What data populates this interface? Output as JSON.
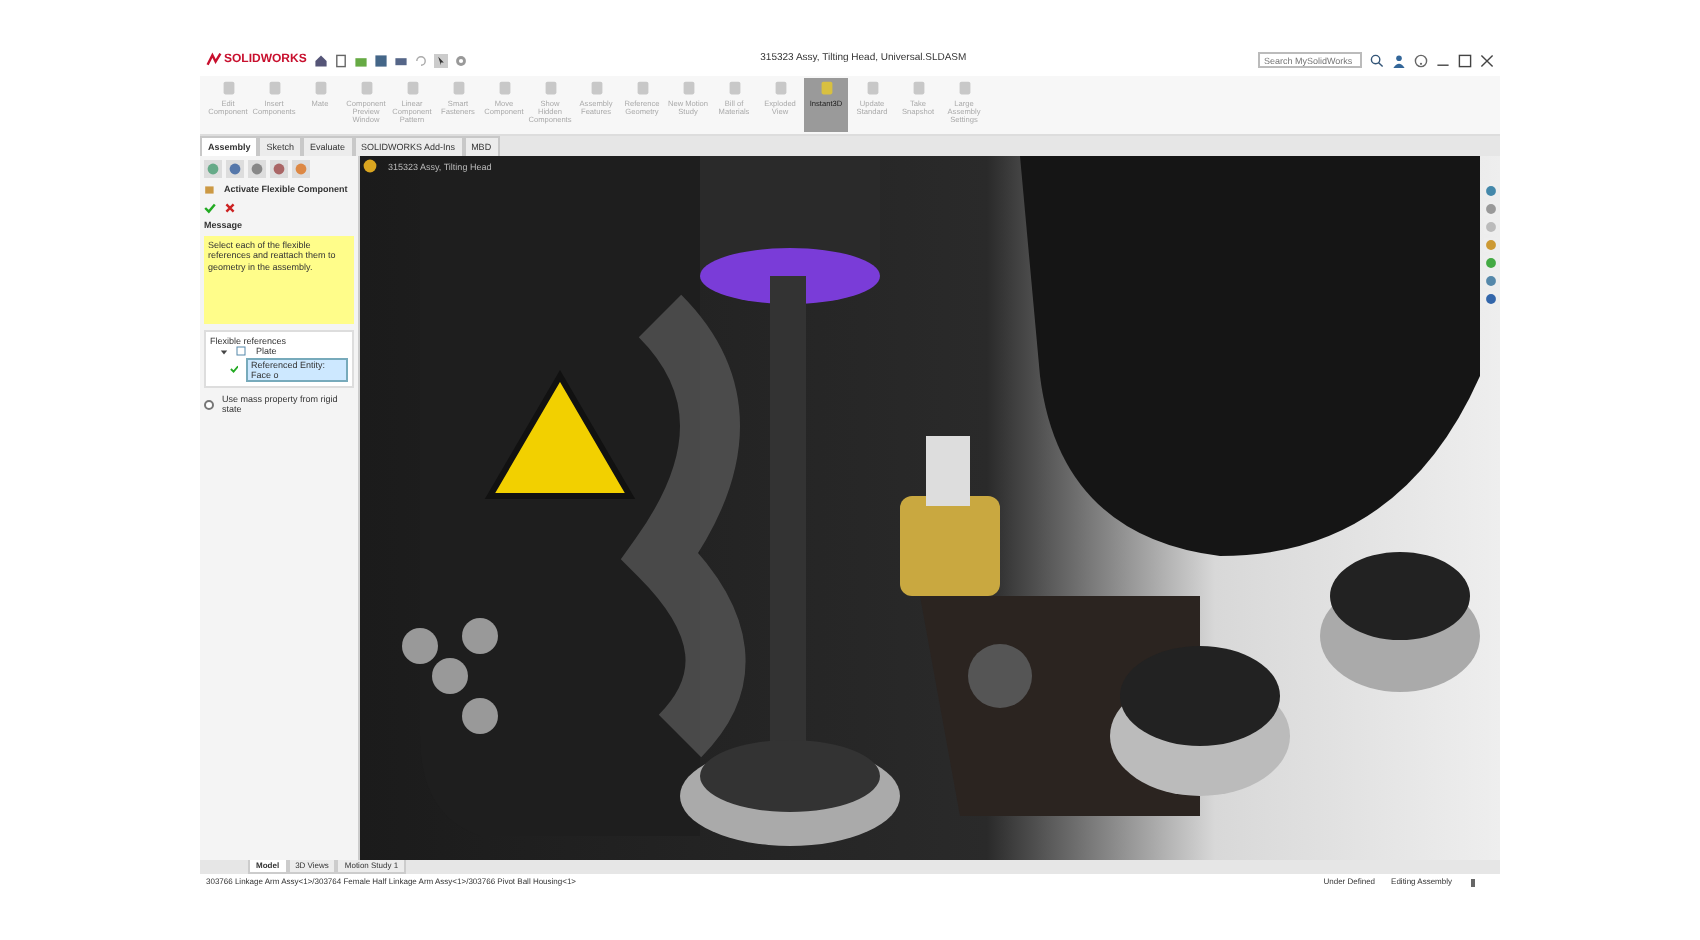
{
  "window": {
    "logo": "SOLIDWORKS",
    "title": "315323 Assy, Tilting Head, Universal.SLDASM"
  },
  "search": {
    "placeholder": "Search MySolidWorks"
  },
  "ribbon": [
    {
      "label": "Edit Component",
      "selected": false,
      "disabled": true
    },
    {
      "label": "Insert Components",
      "selected": false,
      "disabled": true
    },
    {
      "label": "Mate",
      "selected": false,
      "disabled": true
    },
    {
      "label": "Component Preview Window",
      "selected": false,
      "disabled": true
    },
    {
      "label": "Linear Component Pattern",
      "selected": false,
      "disabled": true
    },
    {
      "label": "Smart Fasteners",
      "selected": false,
      "disabled": true
    },
    {
      "label": "Move Component",
      "selected": false,
      "disabled": true
    },
    {
      "label": "Show Hidden Components",
      "selected": false,
      "disabled": true
    },
    {
      "label": "Assembly Features",
      "selected": false,
      "disabled": true
    },
    {
      "label": "Reference Geometry",
      "selected": false,
      "disabled": true
    },
    {
      "label": "New Motion Study",
      "selected": false,
      "disabled": true
    },
    {
      "label": "Bill of Materials",
      "selected": false,
      "disabled": true
    },
    {
      "label": "Exploded View",
      "selected": false,
      "disabled": true
    },
    {
      "label": "Instant3D",
      "selected": true,
      "disabled": false
    },
    {
      "label": "Update Standard",
      "selected": false,
      "disabled": true
    },
    {
      "label": "Take Snapshot",
      "selected": false,
      "disabled": true
    },
    {
      "label": "Large Assembly Settings",
      "selected": false,
      "disabled": true
    }
  ],
  "command_tabs": [
    {
      "label": "Assembly",
      "selected": true
    },
    {
      "label": "Sketch",
      "selected": false
    },
    {
      "label": "Evaluate",
      "selected": false
    },
    {
      "label": "SOLIDWORKS Add-Ins",
      "selected": false
    },
    {
      "label": "MBD",
      "selected": false
    }
  ],
  "property_manager": {
    "title": "Activate Flexible Component",
    "message_title": "Message",
    "message": "Select each of the flexible references and reattach them to geometry in the assembly.",
    "references_title": "Flexible references",
    "tree": [
      {
        "label": "Plate",
        "expanded": true,
        "children": [
          {
            "label": "Referenced Entity: Face o",
            "selected": true
          }
        ]
      }
    ],
    "options": [
      {
        "label": "Use mass property from rigid state",
        "checked": false
      }
    ]
  },
  "viewport": {
    "breadcrumb": "315323 Assy, Tilting Head"
  },
  "bottom_tabs": [
    {
      "label": "Model",
      "selected": true
    },
    {
      "label": "3D Views",
      "selected": false
    },
    {
      "label": "Motion Study 1",
      "selected": false
    }
  ],
  "status_bar": {
    "path": "303766 Linkage Arm Assy<1>/303764 Female Half Linkage Arm Assy<1>/303766 Pivot Ball Housing<1>",
    "items": [
      "Under Defined",
      "Editing Assembly"
    ]
  }
}
